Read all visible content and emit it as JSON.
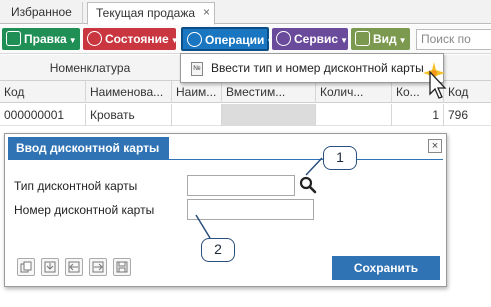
{
  "tabs": [
    {
      "label": "Избранное"
    },
    {
      "label": "Текущая продажа",
      "close": "×"
    }
  ],
  "toolbar": {
    "pravka": "Правка",
    "state": "Состояние",
    "operations": "Операции",
    "service": "Сервис",
    "view": "Вид",
    "search_placeholder": "Поиск по полю"
  },
  "grid": {
    "group_header": "Номенклатура",
    "columns": [
      "Код",
      "Наименова...",
      "Наим...",
      "Вместим...",
      "Колич...",
      "Ко...",
      "Код"
    ],
    "rows": [
      {
        "code": "000000001",
        "name": "Кровать",
        "c3": "",
        "c4": "",
        "c5": "",
        "qty": "1",
        "code2": "796"
      }
    ]
  },
  "menu": {
    "item_label": "Ввести тип и номер дисконтной карты",
    "item_icon": "document-icon"
  },
  "dialog": {
    "title": "Ввод дисконтной карты",
    "close": "×",
    "card_type_label": "Тип дисконтной карты",
    "card_type_value": "",
    "card_number_label": "Номер дисконтной карты",
    "card_number_value": "",
    "save_label": "Сохранить"
  },
  "callouts": {
    "one": "1",
    "two": "2"
  },
  "colors": {
    "pravka": "#1f8f55",
    "state": "#c9363f",
    "operations": "#1a76c0",
    "service": "#6a4a9b",
    "view": "#7c9a4f",
    "dialog_accent": "#2f73b5"
  }
}
